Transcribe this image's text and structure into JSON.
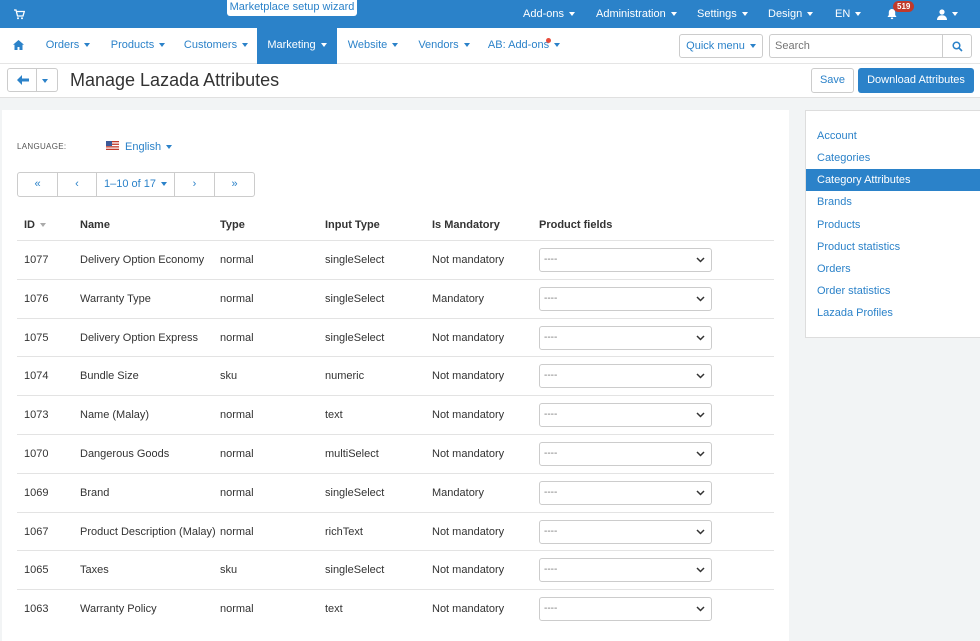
{
  "topbar": {
    "wizard_label": "Marketplace setup wizard",
    "menu": [
      "Add-ons",
      "Administration",
      "Settings",
      "Design",
      "EN"
    ],
    "notifications_count": "519"
  },
  "nav": {
    "items": [
      "Orders",
      "Products",
      "Customers",
      "Marketing",
      "Website",
      "Vendors",
      "AB: Add-ons"
    ],
    "active": "Marketing",
    "quick_menu": "Quick menu",
    "search_placeholder": "Search"
  },
  "page": {
    "title": "Manage Lazada Attributes",
    "save_label": "Save",
    "download_label": "Download Attributes"
  },
  "language": {
    "label": "LANGUAGE:",
    "value": "English"
  },
  "pagination": {
    "first": "«",
    "prev": "‹",
    "range": "1–10 of 17",
    "next": "›",
    "last": "»"
  },
  "table": {
    "headers": [
      "ID",
      "Name",
      "Type",
      "Input Type",
      "Is Mandatory",
      "Product fields"
    ],
    "rows": [
      {
        "id": "1077",
        "name": "Delivery Option Economy",
        "type": "normal",
        "input": "singleSelect",
        "mandatory": "Not mandatory",
        "field": "----"
      },
      {
        "id": "1076",
        "name": "Warranty Type",
        "type": "normal",
        "input": "singleSelect",
        "mandatory": "Mandatory",
        "field": "----"
      },
      {
        "id": "1075",
        "name": "Delivery Option Express",
        "type": "normal",
        "input": "singleSelect",
        "mandatory": "Not mandatory",
        "field": "----"
      },
      {
        "id": "1074",
        "name": "Bundle Size",
        "type": "sku",
        "input": "numeric",
        "mandatory": "Not mandatory",
        "field": "----"
      },
      {
        "id": "1073",
        "name": "Name (Malay)",
        "type": "normal",
        "input": "text",
        "mandatory": "Not mandatory",
        "field": "----"
      },
      {
        "id": "1070",
        "name": "Dangerous Goods",
        "type": "normal",
        "input": "multiSelect",
        "mandatory": "Not mandatory",
        "field": "----"
      },
      {
        "id": "1069",
        "name": "Brand",
        "type": "normal",
        "input": "singleSelect",
        "mandatory": "Mandatory",
        "field": "----"
      },
      {
        "id": "1067",
        "name": "Product Description (Malay)",
        "type": "normal",
        "input": "richText",
        "mandatory": "Not mandatory",
        "field": "----"
      },
      {
        "id": "1065",
        "name": "Taxes",
        "type": "sku",
        "input": "singleSelect",
        "mandatory": "Not mandatory",
        "field": "----"
      },
      {
        "id": "1063",
        "name": "Warranty Policy",
        "type": "normal",
        "input": "text",
        "mandatory": "Not mandatory",
        "field": "----"
      }
    ]
  },
  "sidebar": {
    "items": [
      "Account",
      "Categories",
      "Category Attributes",
      "Brands",
      "Products",
      "Product statistics",
      "Orders",
      "Order statistics",
      "Lazada Profiles"
    ],
    "active": "Category Attributes"
  },
  "colors": {
    "primary": "#2b82c9",
    "badge": "#c0392b",
    "background": "#f2f4f5"
  },
  "icons": [
    "cart-icon",
    "bell-icon",
    "user-icon",
    "home-icon",
    "search-icon",
    "arrow-left-icon",
    "chevron-down-icon",
    "us-flag-icon"
  ]
}
